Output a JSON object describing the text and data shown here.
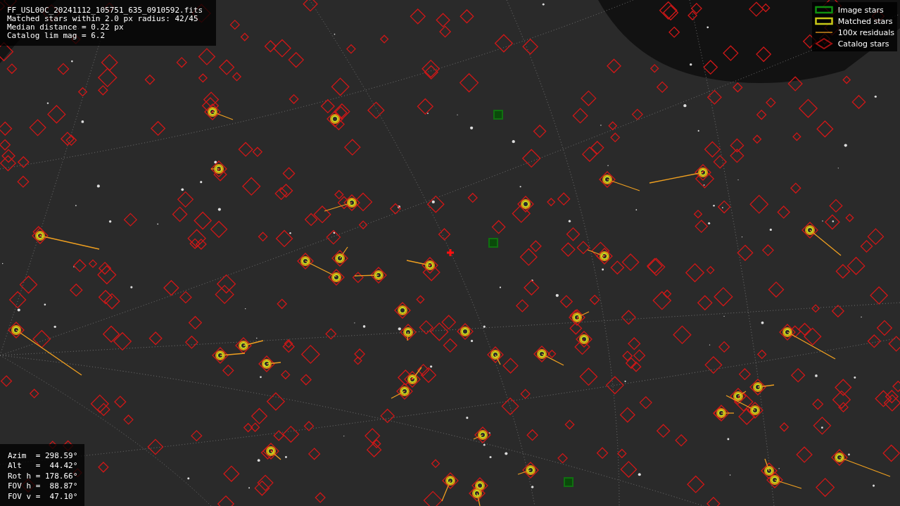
{
  "file_info": {
    "lines": [
      "FF_USL00C_20241112_105751_635_0910592.fits",
      "Matched stars within 2.0 px radius: 42/45",
      "Median distance = 0.22 px",
      "Catalog lim mag = 6.2"
    ]
  },
  "legend": {
    "items": [
      {
        "kind": "image",
        "label": "Image stars"
      },
      {
        "kind": "matched",
        "label": "Matched stars"
      },
      {
        "kind": "residual",
        "label": "100x residuals"
      },
      {
        "kind": "catalog",
        "label": "Catalog stars"
      }
    ]
  },
  "pointing": {
    "lines": [
      "Azim  = 298.59°",
      "Alt   =  44.42°",
      "Rot h = 178.66°",
      "FOV h =  88.87°",
      "FOV v =  47.10°"
    ]
  }
}
